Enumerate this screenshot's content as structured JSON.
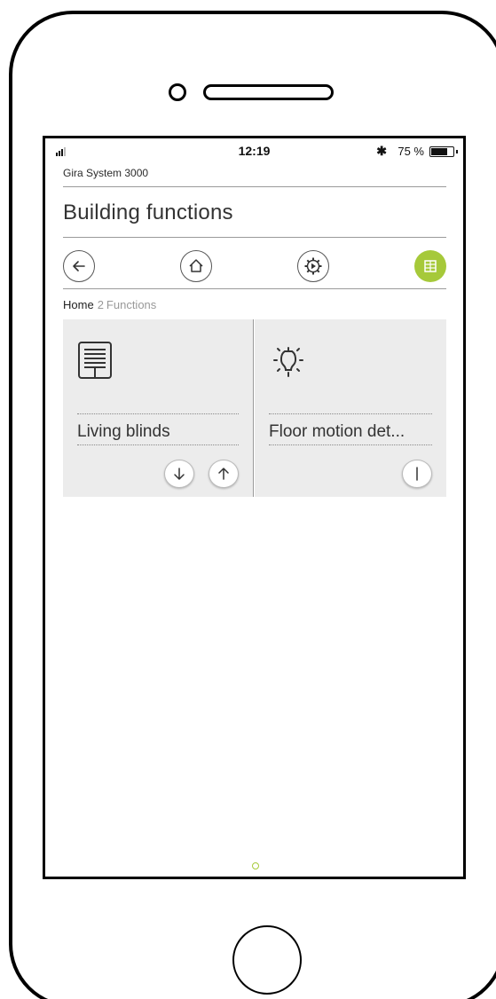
{
  "status_bar": {
    "time": "12:19",
    "bluetooth_icon": "✱",
    "battery_text": "75 %",
    "battery_level": 0.75
  },
  "header": {
    "system_name": "Gira System 3000",
    "title": "Building functions"
  },
  "nav": {
    "buttons": [
      {
        "icon": "back-arrow-icon"
      },
      {
        "icon": "home-icon"
      },
      {
        "icon": "gear-play-icon"
      },
      {
        "icon": "grid-icon"
      }
    ],
    "accent_color": "#a6c93a"
  },
  "breadcrumb": {
    "home": "Home",
    "count": "2",
    "label": "Functions"
  },
  "tiles": [
    {
      "label": "Living blinds",
      "icon": "blinds-icon",
      "controls": [
        "arrow-down-icon",
        "arrow-up-icon"
      ]
    },
    {
      "label": "Floor motion det...",
      "icon": "light-bulb-icon",
      "controls": [
        "toggle-line-icon"
      ]
    }
  ]
}
